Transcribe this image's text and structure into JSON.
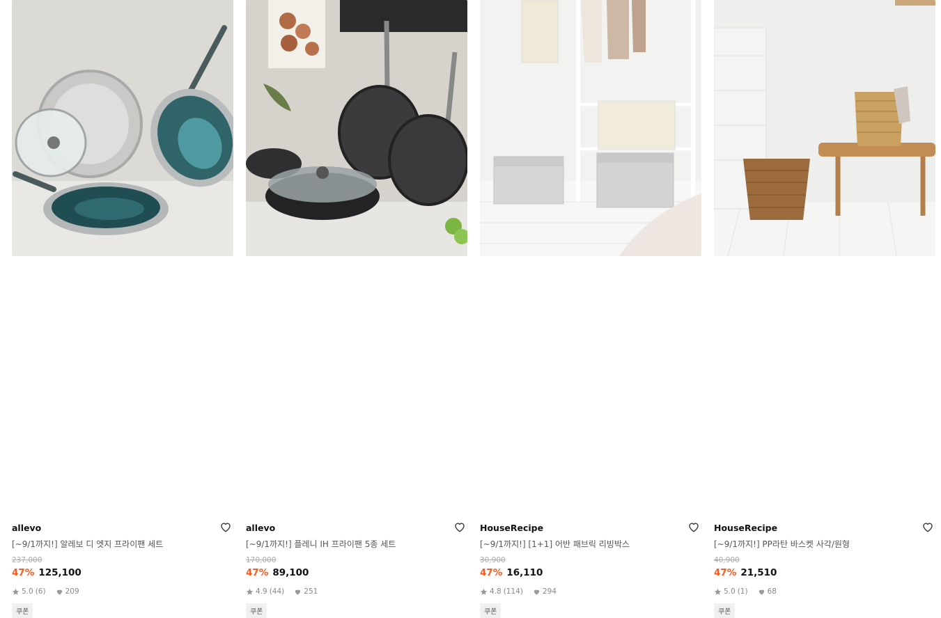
{
  "products": [
    {
      "brand": "allevo",
      "title": "[~9/1까지!] 알레보 디 엣지 프라이팬 세트",
      "original_price": "237,000",
      "discount": "47%",
      "price": "125,100",
      "rating": "5.0",
      "review_count": "(6)",
      "likes": "209",
      "coupon": "쿠폰",
      "image_icon": "frying-pan-set-image"
    },
    {
      "brand": "allevo",
      "title": "[~9/1까지!] 플레니 IH 프라이팬 5종 세트",
      "original_price": "170,000",
      "discount": "47%",
      "price": "89,100",
      "rating": "4.9",
      "review_count": "(44)",
      "likes": "251",
      "coupon": "쿠폰",
      "image_icon": "frying-pan-5pc-image"
    },
    {
      "brand": "HouseRecipe",
      "title": "[~9/1까지!] [1+1] 어반 패브릭 리빙박스",
      "original_price": "30,900",
      "discount": "47%",
      "price": "16,110",
      "rating": "4.8",
      "review_count": "(114)",
      "likes": "294",
      "coupon": "쿠폰",
      "image_icon": "fabric-storage-box-image"
    },
    {
      "brand": "HouseRecipe",
      "title": "[~9/1까지!] PP라탄 바스켓 사각/원형",
      "original_price": "40,900",
      "discount": "47%",
      "price": "21,510",
      "rating": "5.0",
      "review_count": "(1)",
      "likes": "68",
      "coupon": "쿠폰",
      "image_icon": "rattan-basket-image"
    }
  ],
  "colors": {
    "discount": "#f05a22",
    "original_price": "#aaaaaa",
    "text": "#111111"
  }
}
